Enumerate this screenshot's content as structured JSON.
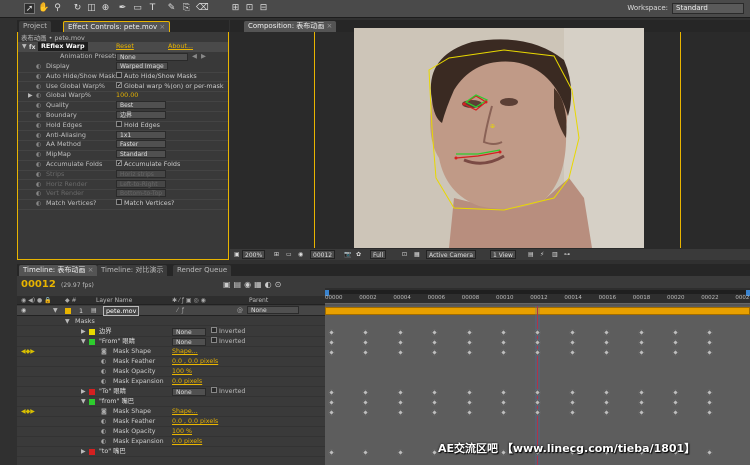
{
  "toolbar": {
    "workspace_label": "Workspace:",
    "workspace_value": "Standard"
  },
  "left_panel": {
    "tabs": [
      "Project",
      "Effect Controls: pete.mov"
    ],
    "breadcrumb": "表布动画 • pete.mov",
    "effect_name": "REflex Warp",
    "reset": "Reset",
    "about": "About...",
    "presets_label": "Animation Presets:",
    "presets_value": "None",
    "rows": [
      {
        "name": "Display",
        "val": "Warped Image",
        "type": "dd"
      },
      {
        "name": "Auto Hide/Show Masks",
        "val": "Auto Hide/Show Masks",
        "type": "chk",
        "checked": false
      },
      {
        "name": "Use Global Warp%",
        "val": "Global warp %(on) or per-mask",
        "type": "chk",
        "checked": true
      },
      {
        "name": "Global Warp%",
        "val": "100.00",
        "type": "num"
      },
      {
        "name": "Quality",
        "val": "Best",
        "type": "dd"
      },
      {
        "name": "Boundary",
        "val": "边界",
        "type": "dd"
      },
      {
        "name": "Hold Edges",
        "val": "Hold Edges",
        "type": "chk",
        "checked": false
      },
      {
        "name": "Anti-Aliasing",
        "val": "1x1",
        "type": "dd"
      },
      {
        "name": "AA Method",
        "val": "Faster",
        "type": "dd"
      },
      {
        "name": "MipMap",
        "val": "Standard",
        "type": "dd"
      },
      {
        "name": "Accumulate Folds",
        "val": "Accumulate Folds",
        "type": "chk",
        "checked": true
      },
      {
        "name": "Strips",
        "val": "Horiz strips",
        "type": "dd",
        "disabled": true
      },
      {
        "name": "Horiz Render",
        "val": "Left-to-Right",
        "type": "dd",
        "disabled": true
      },
      {
        "name": "Vert Render",
        "val": "Bottom-to-Top",
        "type": "dd",
        "disabled": true
      },
      {
        "name": "Match Vertices?",
        "val": "Match Vertices?",
        "type": "chk",
        "checked": false
      }
    ]
  },
  "composition": {
    "tab": "Composition: 表布动画",
    "zoom": "200%",
    "timecode": "00012",
    "resolution": "Full",
    "camera": "Active Camera",
    "views": "1 View"
  },
  "timeline": {
    "tabs": [
      "Timeline: 表布动画",
      "Timeline: 对比演示",
      "Render Queue"
    ],
    "timecode": "00012",
    "fps": "(29.97 fps)",
    "col_layer_name": "Layer Name",
    "col_parent": "Parent",
    "layer_num": "1",
    "layer_name": "pete.mov",
    "parent_value": "None",
    "ruler": [
      "00000",
      "00002",
      "00004",
      "00006",
      "00008",
      "00010",
      "00012",
      "00014",
      "00016",
      "00018",
      "00020",
      "00022",
      "0002"
    ],
    "masks_label": "Masks",
    "rows": [
      {
        "kind": "mask",
        "label": "边界",
        "color": "#e8d800",
        "mode": "None",
        "inverted": "Inverted"
      },
      {
        "kind": "mask",
        "label": "\"From\" 眼睛",
        "color": "#2ecc2e",
        "mode": "None",
        "inverted": "Inverted"
      },
      {
        "kind": "prop",
        "label": "Mask Shape",
        "value": "Shape..."
      },
      {
        "kind": "prop",
        "label": "Mask Feather",
        "value": "0.0 , 0.0 pixels"
      },
      {
        "kind": "prop",
        "label": "Mask Opacity",
        "value": "100 %"
      },
      {
        "kind": "prop",
        "label": "Mask Expansion",
        "value": "0.0 pixels"
      },
      {
        "kind": "mask",
        "label": "\"To\" 眼睛",
        "color": "#d42020",
        "mode": "None",
        "inverted": "Inverted"
      },
      {
        "kind": "mask",
        "label": "\"from\" 嘴巴",
        "color": "#2ecc2e",
        "mode": "",
        "inverted": ""
      },
      {
        "kind": "prop",
        "label": "Mask Shape",
        "value": "Shape..."
      },
      {
        "kind": "prop",
        "label": "Mask Feather",
        "value": "0.0 , 0.0 pixels"
      },
      {
        "kind": "prop",
        "label": "Mask Opacity",
        "value": "100 %"
      },
      {
        "kind": "prop",
        "label": "Mask Expansion",
        "value": "0.0 pixels"
      },
      {
        "kind": "mask",
        "label": "\"to\" 嘴巴",
        "color": "#d42020",
        "mode": "",
        "inverted": ""
      }
    ]
  },
  "watermark": "AE交流区吧 【www.linecg.com/tieba/1801】"
}
